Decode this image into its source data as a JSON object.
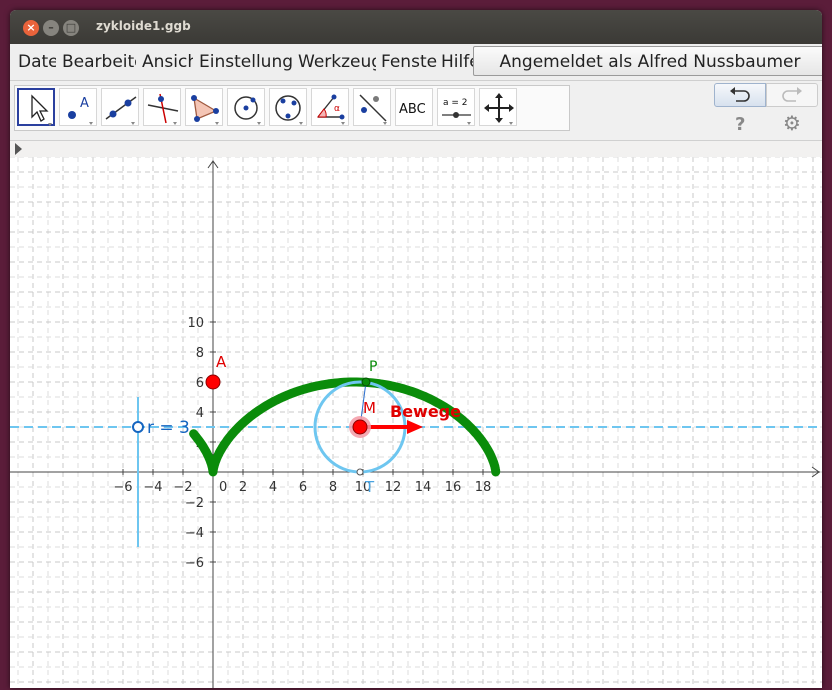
{
  "window": {
    "title": "zykloide1.ggb"
  },
  "menubar": {
    "items": [
      "Datei",
      "Bearbeiten",
      "Ansicht",
      "Einstellungen",
      "Werkzeuge",
      "Fenster",
      "Hilfe"
    ],
    "login": "Angemeldet als Alfred Nussbaumer"
  },
  "toolbar": {
    "tools": [
      {
        "name": "move-tool-button",
        "icon": "pointer-arrow"
      },
      {
        "name": "point-tool-button",
        "icon": "point-a"
      },
      {
        "name": "line-tool-button",
        "icon": "line-through-points"
      },
      {
        "name": "perpendicular-tool-button",
        "icon": "perpendicular-line"
      },
      {
        "name": "polygon-tool-button",
        "icon": "triangle"
      },
      {
        "name": "circle-center-point-tool-button",
        "icon": "circle-center"
      },
      {
        "name": "circle-three-points-tool-button",
        "icon": "circle-three-points"
      },
      {
        "name": "angle-tool-button",
        "icon": "angle"
      },
      {
        "name": "reflect-tool-button",
        "icon": "reflect-line"
      },
      {
        "name": "text-tool-button",
        "icon": "text",
        "label": "ABC"
      },
      {
        "name": "slider-tool-button",
        "icon": "slider",
        "label": "a = 2"
      },
      {
        "name": "move-graphics-view-tool-button",
        "icon": "move-cross"
      }
    ],
    "undo_icon": "undo-arrow",
    "redo_icon": "redo-arrow",
    "help_label": "?",
    "settings_icon": "gear"
  },
  "graphics": {
    "x_ticks": [
      "−6",
      "−4",
      "−2",
      "0",
      "2",
      "4",
      "6",
      "8",
      "10",
      "12",
      "14",
      "16",
      "18"
    ],
    "y_ticks": [
      "10",
      "8",
      "6",
      "4",
      "2",
      "−2",
      "−4",
      "−6"
    ],
    "origin_label": "0",
    "point_A_label": "A",
    "point_P_label": "P",
    "point_M_label": "M",
    "slider_label": "r = 3",
    "button_label": "Bewege",
    "touch_point_label": "T",
    "colors": {
      "curve": "#0a8c0a",
      "circle": "#6ec6f0",
      "point_red": "#ff0000",
      "slider": "#6ec6f0",
      "arrow": "#ff0000",
      "label_blue": "#1565c0"
    },
    "objects": {
      "A": [
        0,
        6
      ],
      "M": [
        9.8,
        3
      ],
      "P": [
        10.2,
        6
      ],
      "T": [
        9.8,
        0
      ],
      "r": 3
    }
  }
}
